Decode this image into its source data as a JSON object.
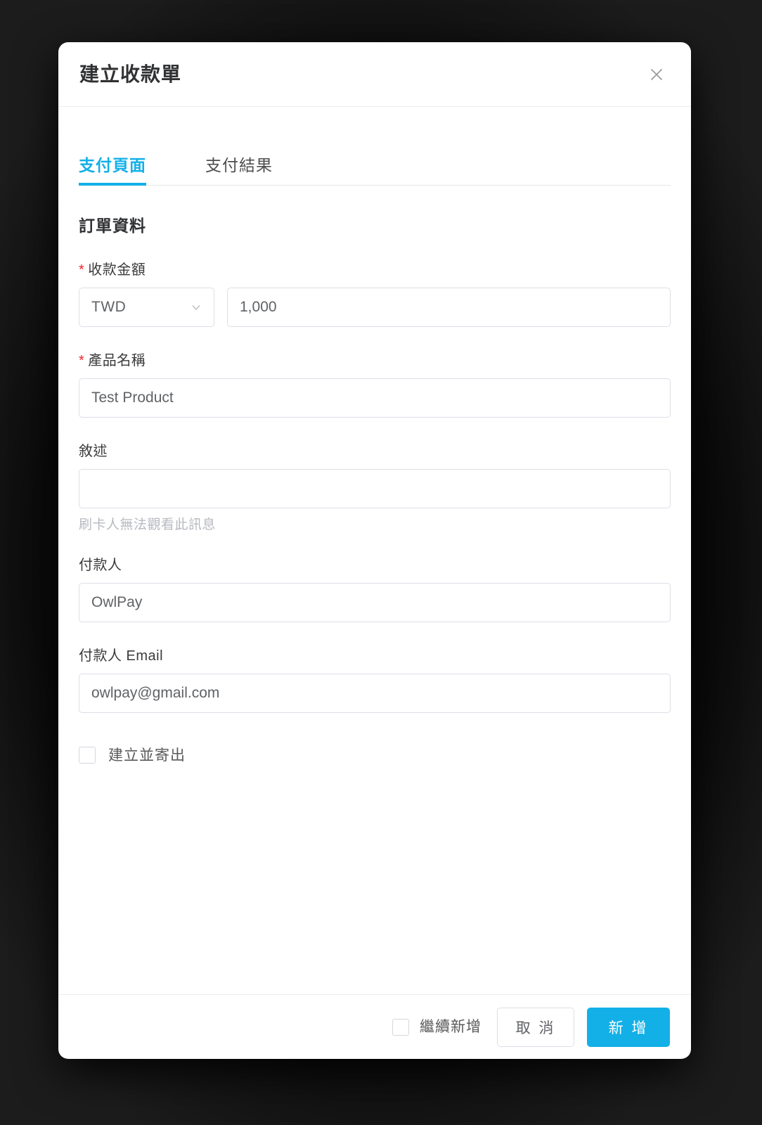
{
  "dialog": {
    "title": "建立收款單",
    "close_icon": "close-icon"
  },
  "tabs": [
    {
      "label": "支付頁面",
      "active": true
    },
    {
      "label": "支付結果",
      "active": false
    }
  ],
  "form": {
    "section_title": "訂單資料",
    "amount": {
      "label": "收款金額",
      "required_mark": "*",
      "currency_value": "TWD",
      "currency_icon": "chevron-down-icon",
      "value": "1,000",
      "placeholder": "1,000"
    },
    "product_name": {
      "label": "產品名稱",
      "required_mark": "*",
      "value": "Test Product",
      "placeholder": "Test Product"
    },
    "description": {
      "label": "敘述",
      "value": "",
      "placeholder": "",
      "helper": "刷卡人無法觀看此訊息"
    },
    "payer": {
      "label": "付款人",
      "value": "OwlPay",
      "placeholder": "OwlPay"
    },
    "payer_email": {
      "label": "付款人 Email",
      "value": "owlpay@gmail.com",
      "placeholder": "owlpay@gmail.com"
    },
    "send_checkbox": {
      "label": "建立並寄出",
      "checked": false
    }
  },
  "footer": {
    "continue_checkbox": {
      "label": "繼續新增",
      "checked": false
    },
    "cancel_label": "取 消",
    "submit_label": "新 增"
  },
  "colors": {
    "accent": "#13b0e8",
    "required": "#f5222d",
    "border": "#dcdfe6",
    "text": "#303133",
    "muted": "#b7bac0"
  }
}
